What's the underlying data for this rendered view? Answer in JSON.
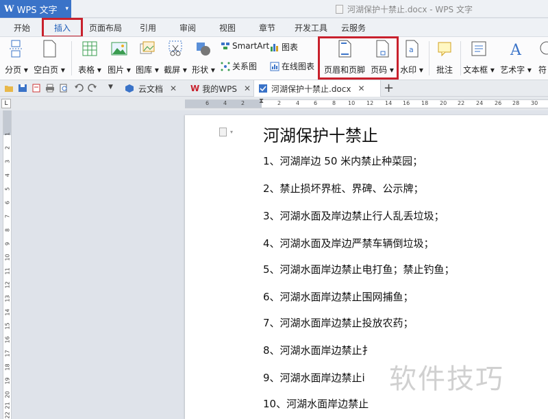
{
  "app": {
    "logo": "W",
    "name": "WPS 文字",
    "window_title": "河湖保护十禁止.docx - WPS 文字"
  },
  "menu": {
    "tabs": [
      "开始",
      "插入",
      "页面布局",
      "引用",
      "审阅",
      "视图",
      "章节",
      "开发工具",
      "云服务"
    ],
    "active": "插入"
  },
  "ribbon": {
    "page_break": "分页",
    "blank_page": "空白页",
    "table": "表格",
    "picture": "图片",
    "gallery": "图库",
    "screenshot": "截屏",
    "shape": "形状",
    "smartart": "SmartArt",
    "chart": "图表",
    "relation": "关系图",
    "online_chart": "在线图表",
    "header_footer": "页眉和页脚",
    "page_number": "页码",
    "watermark": "水印",
    "comment": "批注",
    "textbox": "文本框",
    "wordart": "艺术字",
    "symbol": "符"
  },
  "doc_tabs": [
    {
      "label": "云文档"
    },
    {
      "label": "我的WPS"
    },
    {
      "label": "河湖保护十禁止.docx"
    }
  ],
  "ruler": {
    "h_ticks": [
      "6",
      "4",
      "2",
      "2",
      "4",
      "6",
      "8",
      "10",
      "12",
      "14",
      "16",
      "18",
      "20",
      "22",
      "24",
      "26",
      "28",
      "30",
      "32"
    ],
    "v_ticks": [
      "1",
      "2",
      "3",
      "4",
      "5",
      "6",
      "7",
      "8",
      "9",
      "10",
      "11",
      "12",
      "13",
      "14",
      "15",
      "16",
      "17",
      "18",
      "19",
      "20",
      "21",
      "22"
    ],
    "corner": "L"
  },
  "document": {
    "title": "河湖保护十禁止",
    "lines": [
      "1、河湖岸边 50 米内禁止种菜园；",
      "2、禁止损坏界桩、界碑、公示牌；",
      "3、河湖水面及岸边禁止行人乱丢垃圾；",
      "4、河湖水面及岸边严禁车辆倒垃圾；",
      "5、河湖水面岸边禁止电打鱼；禁止钓鱼；",
      "6、河湖水面岸边禁止围网捕鱼；",
      "7、河湖水面岸边禁止投放农药；",
      "8、河湖水面岸边禁止扌",
      "9、河湖水面岸边禁止i",
      "10、河湖水面岸边禁止"
    ]
  },
  "watermark_text": "软件技巧",
  "colors": {
    "accent": "#3a73c8",
    "highlight": "#c8202c"
  }
}
